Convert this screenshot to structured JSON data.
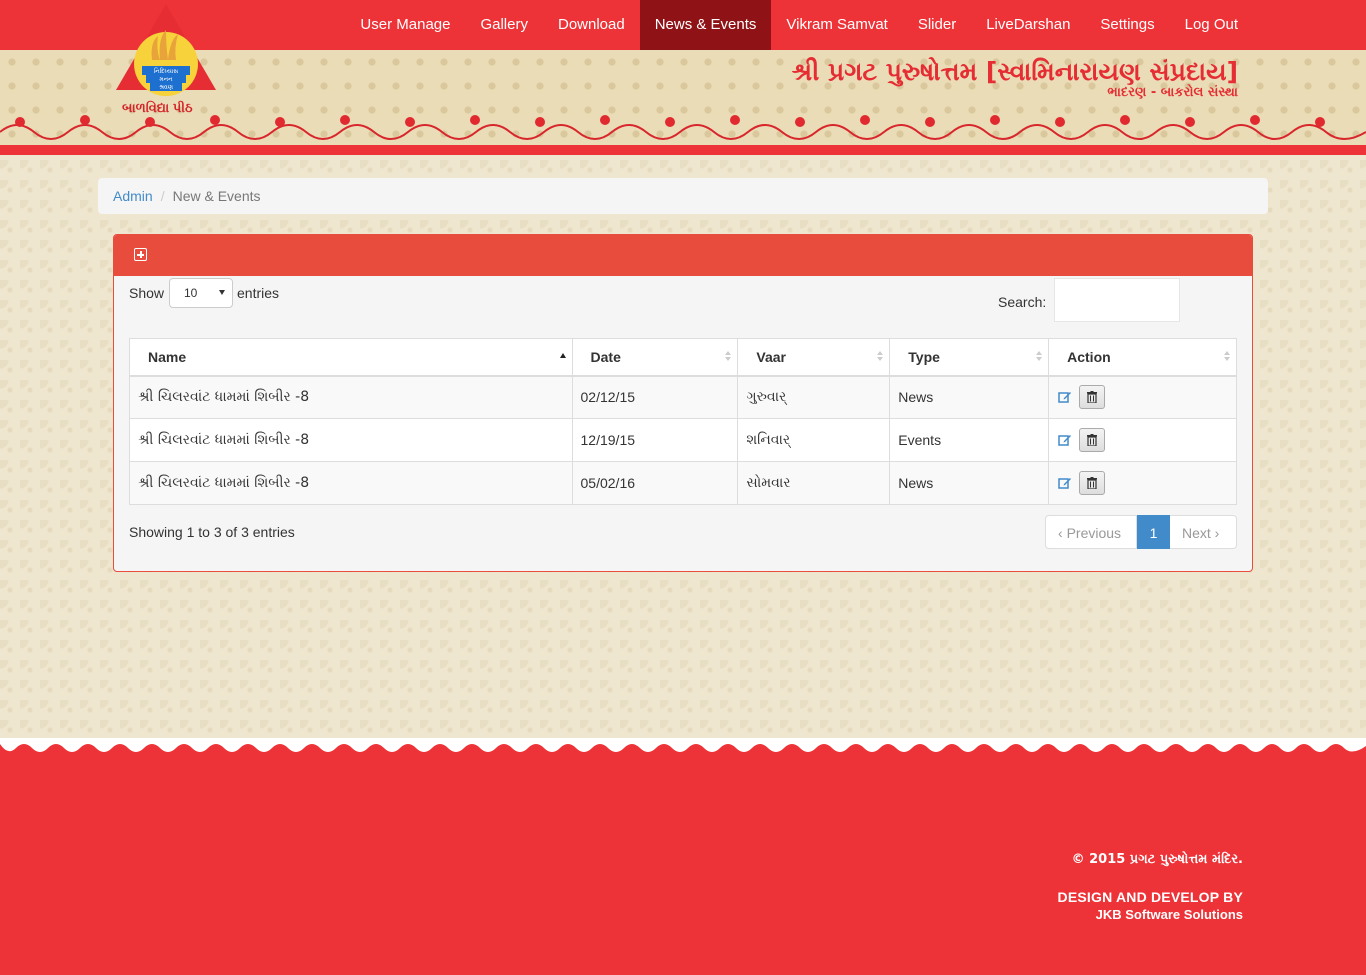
{
  "nav": {
    "items": [
      "User Manage",
      "Gallery",
      "Download",
      "News & Events",
      "Vikram Samvat",
      "Slider",
      "LiveDarshan",
      "Settings",
      "Log Out"
    ],
    "active": "News & Events"
  },
  "logo": {
    "badge_lines": [
      "નિદિધ્યાસ",
      "મનન",
      "શ્રવણ"
    ],
    "caption": "બાળવિદ્યા પીઠ"
  },
  "brand": {
    "title": "શ્રી પ્રગટ પુરુષોત્તમ [સ્વામિનારાયણ સંપ્રદાય]",
    "subtitle": "ભાદરણ - બાકરોલ સંસ્થા"
  },
  "breadcrumb": {
    "root": "Admin",
    "separator": "/",
    "current": "New & Events"
  },
  "table_controls": {
    "show_label": "Show",
    "page_size": "10",
    "entries_label": "entries",
    "search_label": "Search:",
    "search_value": ""
  },
  "table": {
    "columns": [
      "Name",
      "Date",
      "Vaar",
      "Type",
      "Action"
    ],
    "rows": [
      {
        "name": "શ્રી ચિલરવાંટ ધામમાં શિબીર -8",
        "date": "02/12/15",
        "vaar": "ગુરુવાર્",
        "type": "News"
      },
      {
        "name": "શ્રી ચિલરવાંટ ધામમાં શિબીર -8",
        "date": "12/19/15",
        "vaar": "શનિવાર્",
        "type": "Events"
      },
      {
        "name": "શ્રી ચિલરવાંટ ધામમાં શિબીર -8",
        "date": "05/02/16",
        "vaar": "સોમવાર",
        "type": "News"
      }
    ]
  },
  "pagination": {
    "info": "Showing 1 to 3 of 3 entries",
    "previous": "Previous",
    "current_page": "1",
    "next": "Next"
  },
  "footer": {
    "copyright": "© 2015 પ્રગટ પુરુષોત્તમ મંદિર.",
    "design_label": "DESIGN AND DEVELOP BY",
    "company": "JKB Software Solutions"
  },
  "colors": {
    "brand_red": "#ee3338",
    "nav_active": "#8f1216",
    "panel_head": "#e74c3c",
    "link_blue": "#428bca"
  },
  "icons": [
    "add-panel-icon",
    "sort-icon",
    "edit-icon",
    "trash-icon",
    "chevron-left-icon",
    "chevron-right-icon"
  ]
}
